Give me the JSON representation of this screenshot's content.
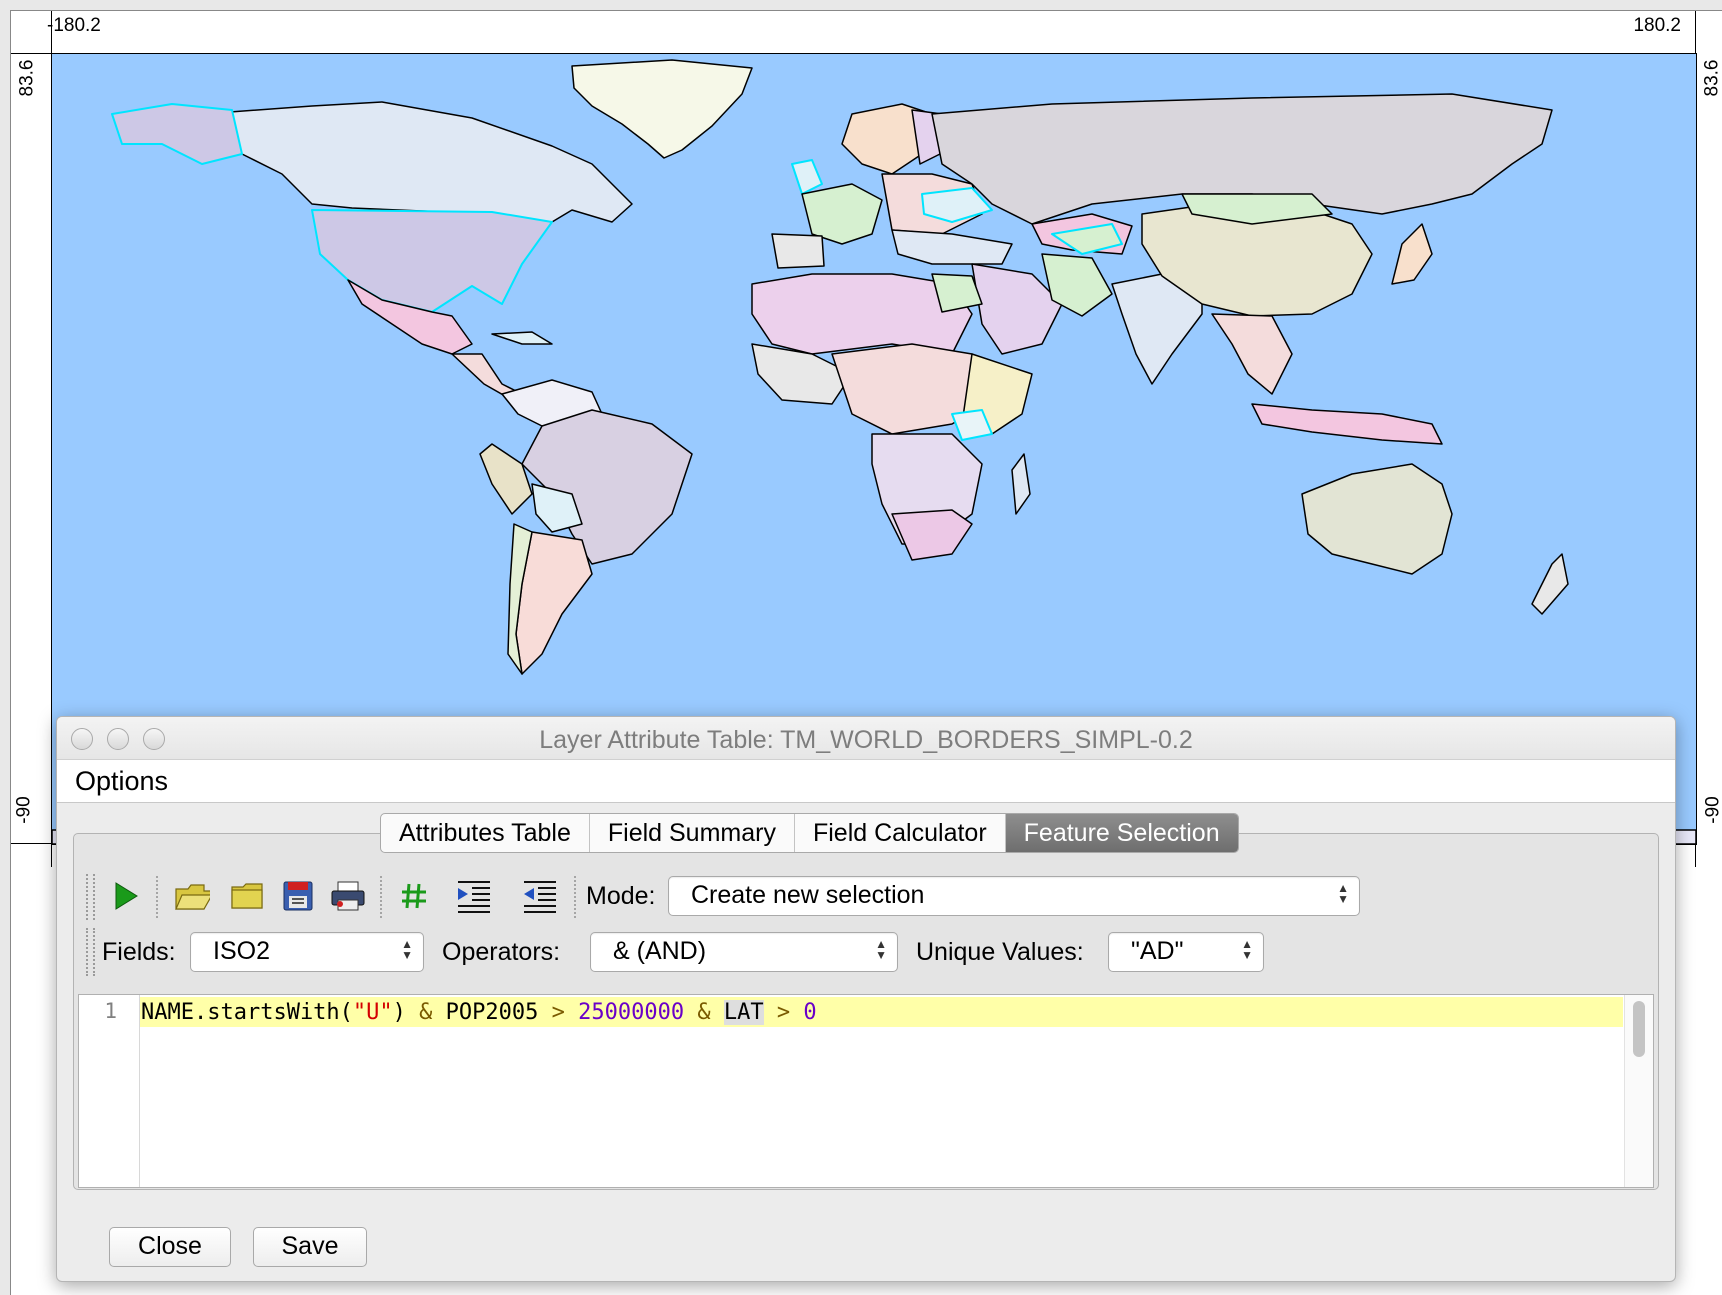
{
  "map": {
    "extent_left": "-180.2",
    "extent_right": "180.2",
    "extent_top": "83.6",
    "extent_bottom": "-90",
    "colors": {
      "ocean": "#99caff",
      "selected_outline": "#00e5ff",
      "land_palette": [
        "#d8dde8",
        "#cdc8e6",
        "#f3c6e0",
        "#f8e0cc",
        "#d6f0d0",
        "#d9d9d9",
        "#e8e2c8",
        "#f4dcdc",
        "#dff1f8",
        "#e4d2ee"
      ]
    }
  },
  "dialog": {
    "title": "Layer Attribute Table: TM_WORLD_BORDERS_SIMPL-0.2",
    "menu": {
      "options": "Options"
    },
    "tabs": [
      "Attributes Table",
      "Field Summary",
      "Field Calculator",
      "Feature Selection"
    ],
    "active_tab": "Feature Selection",
    "toolbar": {
      "icons": [
        "run-icon",
        "open-folder-icon",
        "folder-icon",
        "save-icon",
        "print-icon",
        "hash-icon",
        "indent-icon",
        "outdent-icon"
      ],
      "mode_label": "Mode:",
      "mode_value": "Create new selection"
    },
    "fields_row": {
      "fields_label": "Fields:",
      "fields_value": "ISO2",
      "operators_label": "Operators:",
      "operators_value": "& (AND)",
      "unique_label": "Unique Values:",
      "unique_value": "\"AD\""
    },
    "editor": {
      "line_number": "1",
      "tokens": {
        "t1": "NAME.startsWith(",
        "t2": "\"U\"",
        "t3": ") ",
        "t4": "&",
        "t5": " POP2005 ",
        "t6": ">",
        "t7": " ",
        "t8": "25000000",
        "t9": " ",
        "t10": "&",
        "t11": " ",
        "t12": "LAT",
        "t13": " ",
        "t14": ">",
        "t15": " ",
        "t16": "0"
      }
    },
    "buttons": {
      "close": "Close",
      "save": "Save"
    }
  }
}
